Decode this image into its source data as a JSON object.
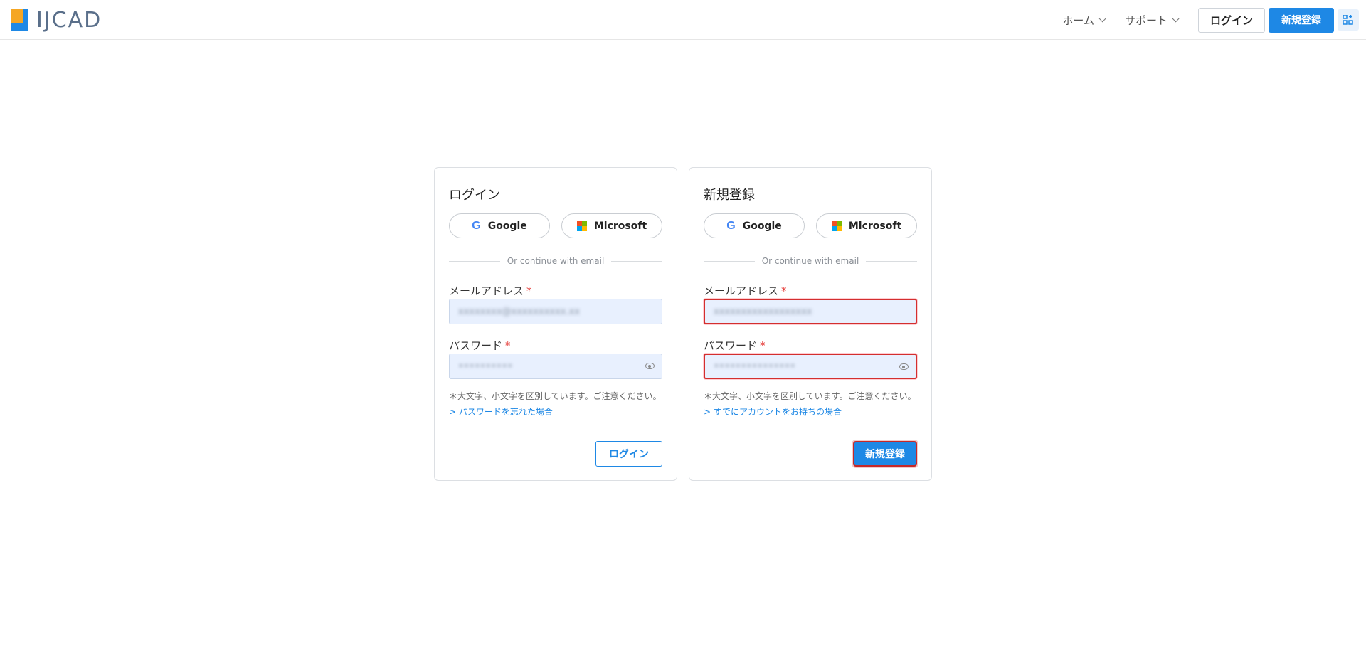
{
  "header": {
    "logo_text": "IJCAD",
    "nav": [
      {
        "label": "ホーム"
      },
      {
        "label": "サポート"
      }
    ],
    "login_label": "ログイン",
    "register_label": "新規登録"
  },
  "login_card": {
    "title": "ログイン",
    "google_label": "Google",
    "microsoft_label": "Microsoft",
    "divider_text": "Or continue with email",
    "email_label": "メールアドレス",
    "email_value": "xxxxxxxx@xxxxxxxxxx.xx",
    "password_label": "パスワード",
    "password_value": "••••••••••",
    "note": "＊大文字、小文字を区別しています。ご注意ください。",
    "link": "> パスワードを忘れた場合",
    "submit_label": "ログイン"
  },
  "register_card": {
    "title": "新規登録",
    "google_label": "Google",
    "microsoft_label": "Microsoft",
    "divider_text": "Or continue with email",
    "email_label": "メールアドレス",
    "email_value": "xxxxxxxxxxxxxxxxxx",
    "password_label": "パスワード",
    "password_value": "•••••••••••••••",
    "note": "＊大文字、小文字を区別しています。ご注意ください。",
    "link": "> すでにアカウントをお持ちの場合",
    "submit_label": "新規登録"
  },
  "required_mark": "*",
  "colors": {
    "primary": "#1e88e5",
    "error": "#d32f2f",
    "logo_orange": "#f5a623"
  }
}
